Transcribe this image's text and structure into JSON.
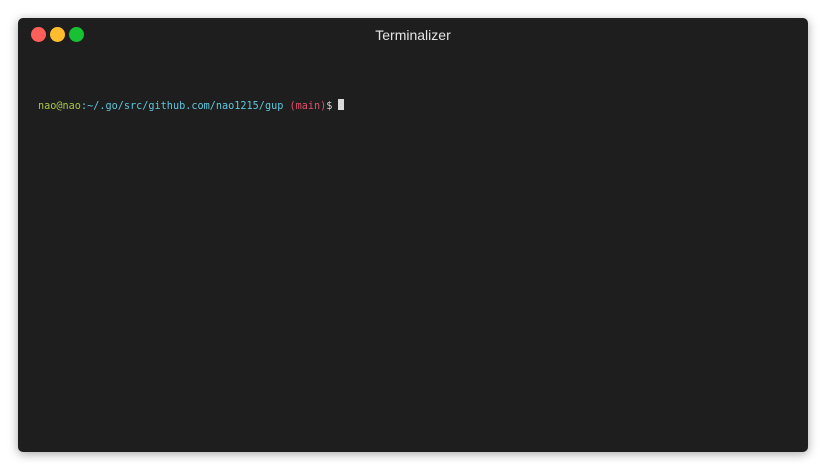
{
  "window": {
    "title": "Terminalizer"
  },
  "colors": {
    "background": "#1e1e1e",
    "user": "#a6c34a",
    "path": "#5fc7dc",
    "branch": "#e0506b",
    "close": "#ff5f58",
    "minimize": "#ffbd2e",
    "zoom": "#18c132"
  },
  "terminal": {
    "prompt": {
      "user_host": "nao@nao",
      "path": ":~/.go/src/github.com/nao1215/gup",
      "branch": " (main)",
      "symbol": "$"
    }
  }
}
